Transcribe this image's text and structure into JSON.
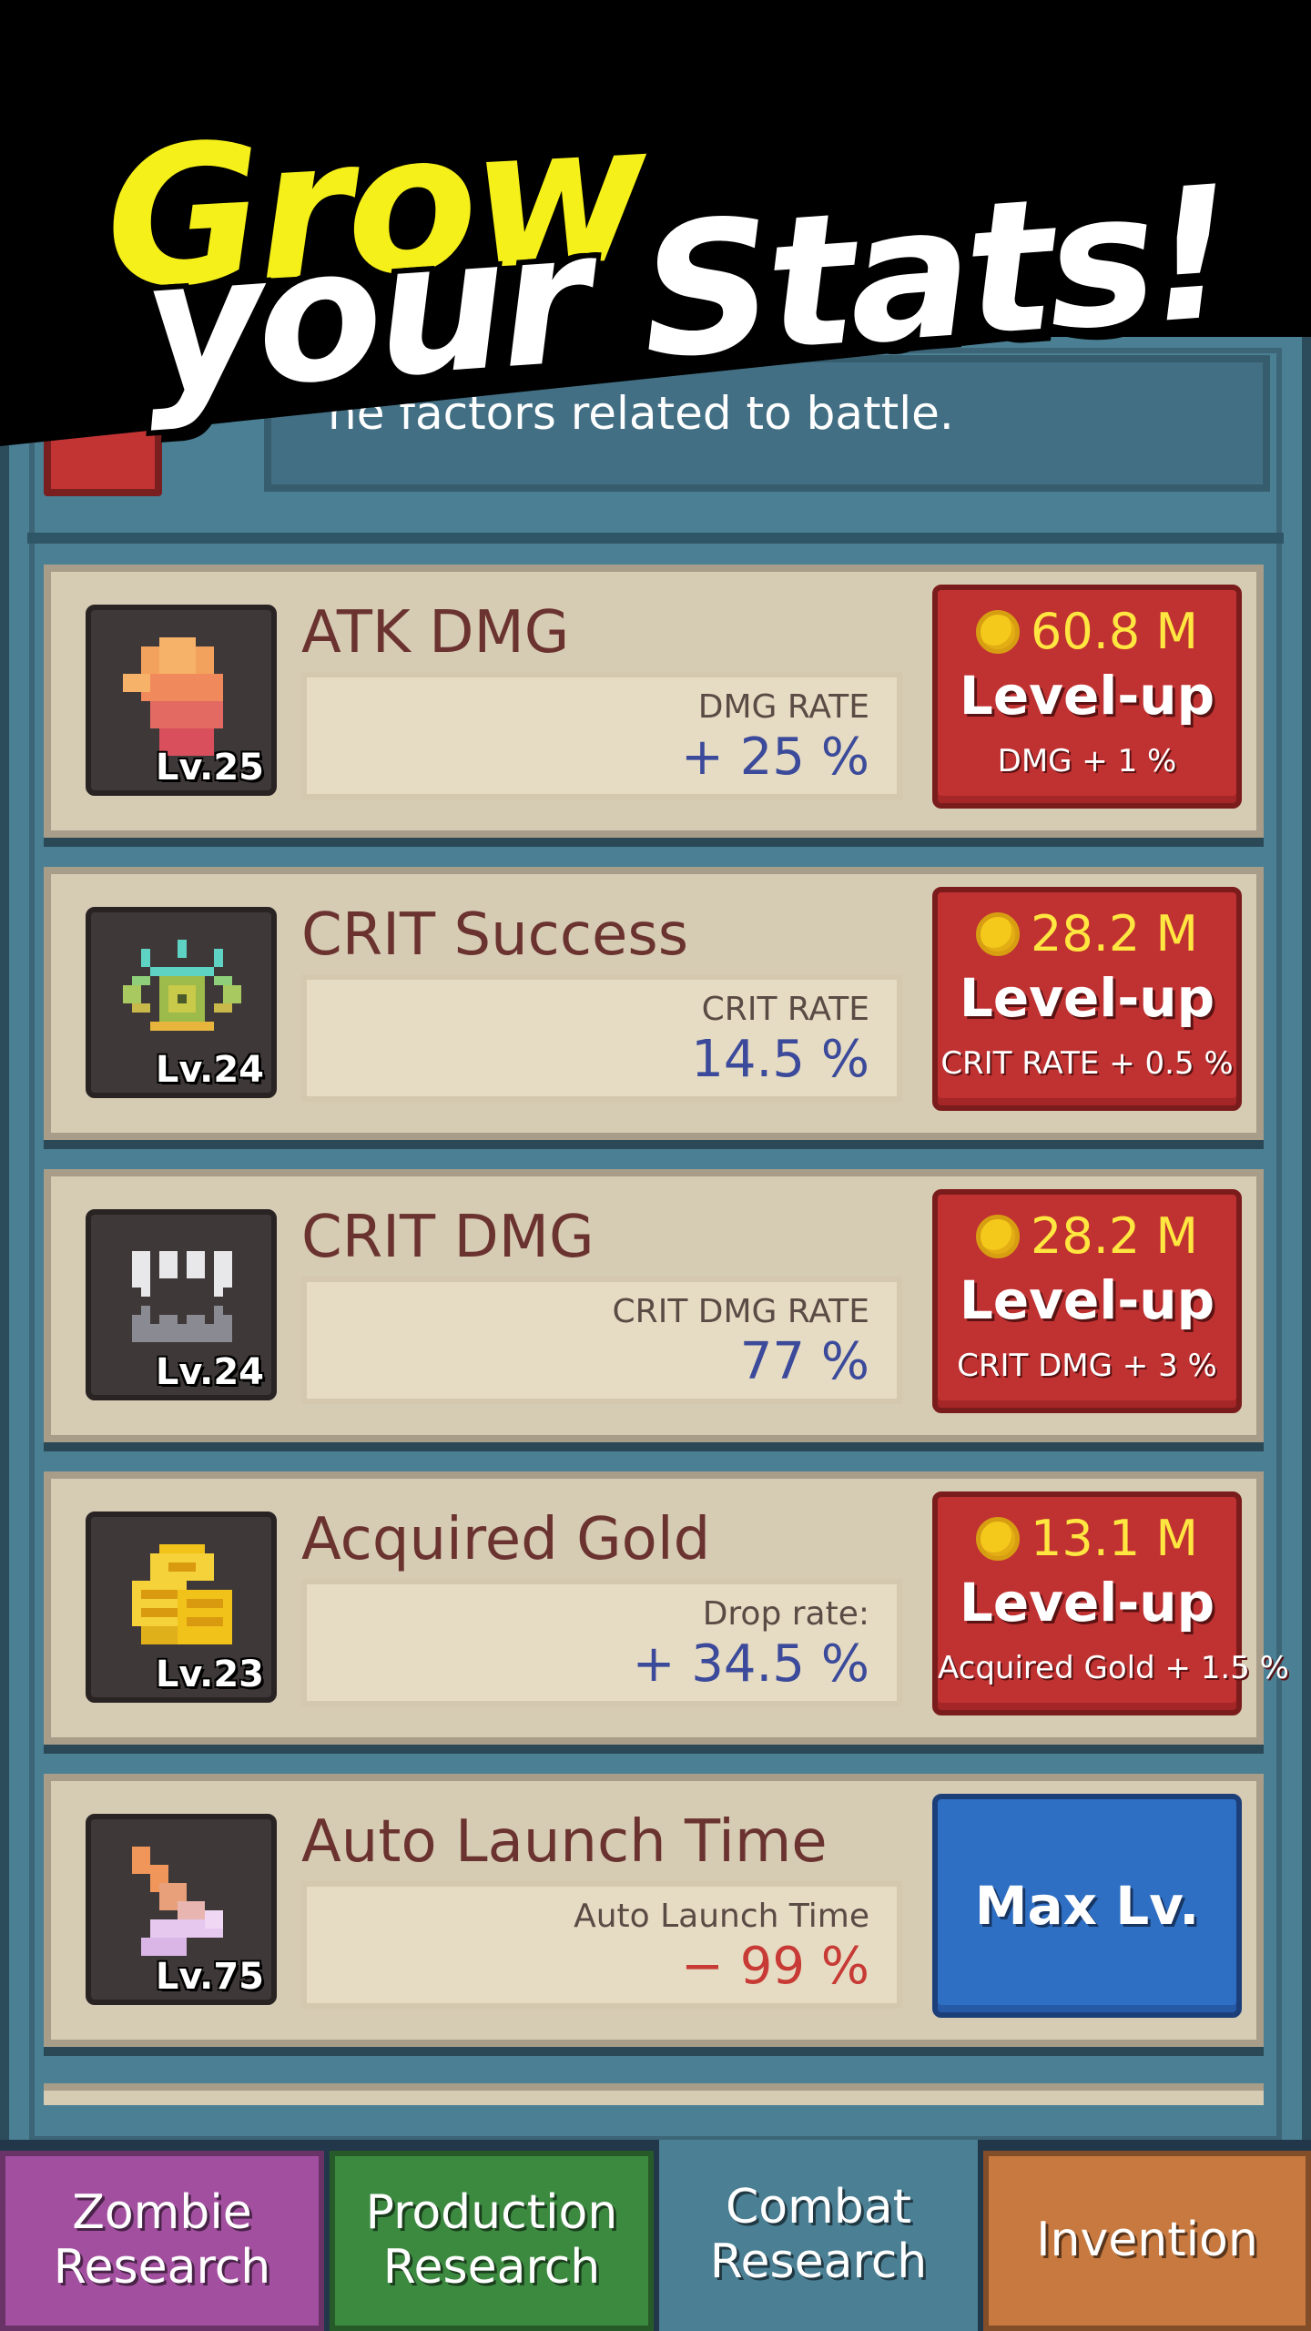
{
  "promo": {
    "line1": "Grow",
    "line2": "your Stats!"
  },
  "header": {
    "description_partial": "he factors related to battle."
  },
  "research_items": [
    {
      "title": "ATK DMG",
      "level": "Lv.25",
      "icon": "fist-icon",
      "stat_label": "DMG RATE",
      "stat_value": "+ 25 %",
      "cost": "60.8 M",
      "button_label": "Level-up",
      "upgrade_effect": "DMG + 1 %"
    },
    {
      "title": "CRIT Success",
      "level": "Lv.24",
      "icon": "eye-icon",
      "stat_label": "CRIT RATE",
      "stat_value": "14.5 %",
      "cost": "28.2 M",
      "button_label": "Level-up",
      "upgrade_effect": "CRIT RATE + 0.5 %"
    },
    {
      "title": "CRIT DMG",
      "level": "Lv.24",
      "icon": "fangs-icon",
      "stat_label": "CRIT DMG RATE",
      "stat_value": "77 %",
      "cost": "28.2 M",
      "button_label": "Level-up",
      "upgrade_effect": "CRIT DMG + 3 %"
    },
    {
      "title": "Acquired Gold",
      "level": "Lv.23",
      "icon": "gold-coins-icon",
      "stat_label": "Drop rate:",
      "stat_value": "+ 34.5 %",
      "cost": "13.1 M",
      "button_label": "Level-up",
      "upgrade_effect": "Acquired Gold + 1.5 %"
    },
    {
      "title": "Auto Launch Time",
      "level": "Lv.75",
      "icon": "stopwatch-hand-icon",
      "stat_label": "Auto Launch Time",
      "stat_value": "− 99 %",
      "button_label": "Max Lv."
    }
  ],
  "tabs": [
    {
      "line1": "Zombie",
      "line2": "Research"
    },
    {
      "line1": "Production",
      "line2": "Research"
    },
    {
      "line1": "Combat",
      "line2": "Research",
      "active": true
    },
    {
      "line1": "Invention",
      "line2": ""
    }
  ],
  "colors": {
    "panel": "#4a7f94",
    "card": "#d6cbb3",
    "levelup_button": "#c03131",
    "max_button": "#2e6fc3",
    "gold_text": "#ffe640",
    "promo_yellow": "#f5ef1a"
  }
}
